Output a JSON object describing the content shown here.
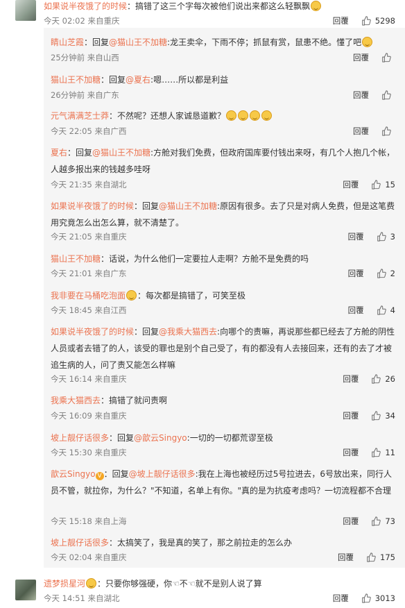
{
  "top_comments": [
    {
      "user": "如果说半夜饿了的时候",
      "text": "：搞错了这三个字每次被他们说出来都这么轻飘飘",
      "time": "今天 02:02 来自重庆",
      "reply_label": "回覆",
      "likes": "5298"
    },
    {
      "user": "遗梦损星河",
      "text": "：只要你够强硬，你",
      "text2": "不",
      "text3": "就不是别人说了算",
      "time": "今天 14:51 来自湖北",
      "reply_label": "回覆",
      "likes": "3013"
    }
  ],
  "replies": [
    {
      "user": "睛山芝霞",
      "prefix": "：回复",
      "at": "@猫山王不加糖",
      "text": ":龙王卖伞，下雨不停；抓鼠有赏，鼠患不绝。懂了吧",
      "time": "25分钟前 来自山西",
      "reply_label": "回覆",
      "likes": ""
    },
    {
      "user": "猫山王不加糖",
      "prefix": "：回复",
      "at": "@夏右",
      "text": ":嗯……所以都是利益",
      "time": "26分钟前 来自广东",
      "reply_label": "回覆",
      "likes": ""
    },
    {
      "user": "元气满满芝士莽",
      "prefix": "",
      "at": "",
      "text": "：不然呢？还想人家诚恳道歉？",
      "time": "今天 22:05 来自广西",
      "reply_label": "回覆",
      "likes": ""
    },
    {
      "user": "夏右",
      "prefix": "：回复",
      "at": "@猫山王不加糖",
      "text": ":方舱对我们免费，但政府国库要付钱出来呀，有几个人抱几个帐，人越多报出来的钱越多哇呀",
      "time": "今天 21:35 来自湖北",
      "reply_label": "回覆",
      "likes": "15"
    },
    {
      "user": "如果说半夜饿了的时候",
      "prefix": "：回复",
      "at": "@猫山王不加糖",
      "text": ":原因有很多。去了只是对病人免费，但是这笔费用究竟怎么出怎么算，就不清楚了。",
      "time": "今天 21:05 来自重庆",
      "reply_label": "回覆",
      "likes": "3"
    },
    {
      "user": "猫山王不加糖",
      "prefix": "",
      "at": "",
      "text": "：话说，为什么他们一定要拉人走啊？方舱不是免费的吗",
      "time": "今天 21:01 来自广东",
      "reply_label": "回覆",
      "likes": "2"
    },
    {
      "user": "我非要在马桶吃泡面",
      "prefix": "",
      "at": "",
      "text": "：每次都是搞错了，可笑至极",
      "time": "今天 18:45 来自江西",
      "reply_label": "回覆",
      "likes": "4"
    },
    {
      "user": "如果说半夜饿了的时候",
      "prefix": "：回复",
      "at": "@我乘大猫西去",
      "text": ":向哪个的责嘛，再说那些都已经去了方舱的阴性人员或者去错了的人，该受的罪也是别个自己受了，有的都没有人去接回来，还有的去了才被追生病的人，问了责又能怎么样嘛",
      "time": "今天 16:14 来自重庆",
      "reply_label": "回覆",
      "likes": "26"
    },
    {
      "user": "我乘大猫西去",
      "prefix": "",
      "at": "",
      "text": "：搞错了就问责啊",
      "time": "今天 16:09 来自重庆",
      "reply_label": "回覆",
      "likes": "34"
    },
    {
      "user": "坡上靓仔话很多",
      "prefix": "：回复",
      "at": "@歆云Singyo",
      "text": ":一切的一切都荒谬至极",
      "time": "今天 15:30 来自重庆",
      "reply_label": "回覆",
      "likes": "11"
    },
    {
      "user": "歆云Singyo",
      "prefix": "：回复",
      "at": "@坡上靓仔话很多",
      "text": ":我在上海也被经历过5号拉进去，6号放出来，同行人员不管，就拉你，为什么？\"不知道，名单上有你。\"真的是为抗疫考虑吗？一切流程都不合理",
      "time": "今天 15:18 来自上海",
      "reply_label": "回覆",
      "likes": "73"
    },
    {
      "user": "坡上靓仔话很多",
      "prefix": "",
      "at": "",
      "text": "：太搞笑了，我是真的笑了，那之前拉走的怎么办",
      "time": "今天 02:04 来自重庆",
      "reply_label": "回覆",
      "likes": "175"
    }
  ],
  "colors": {
    "username": "#eb7350",
    "panel_bg": "#f5f5f5",
    "meta": "#808080"
  }
}
